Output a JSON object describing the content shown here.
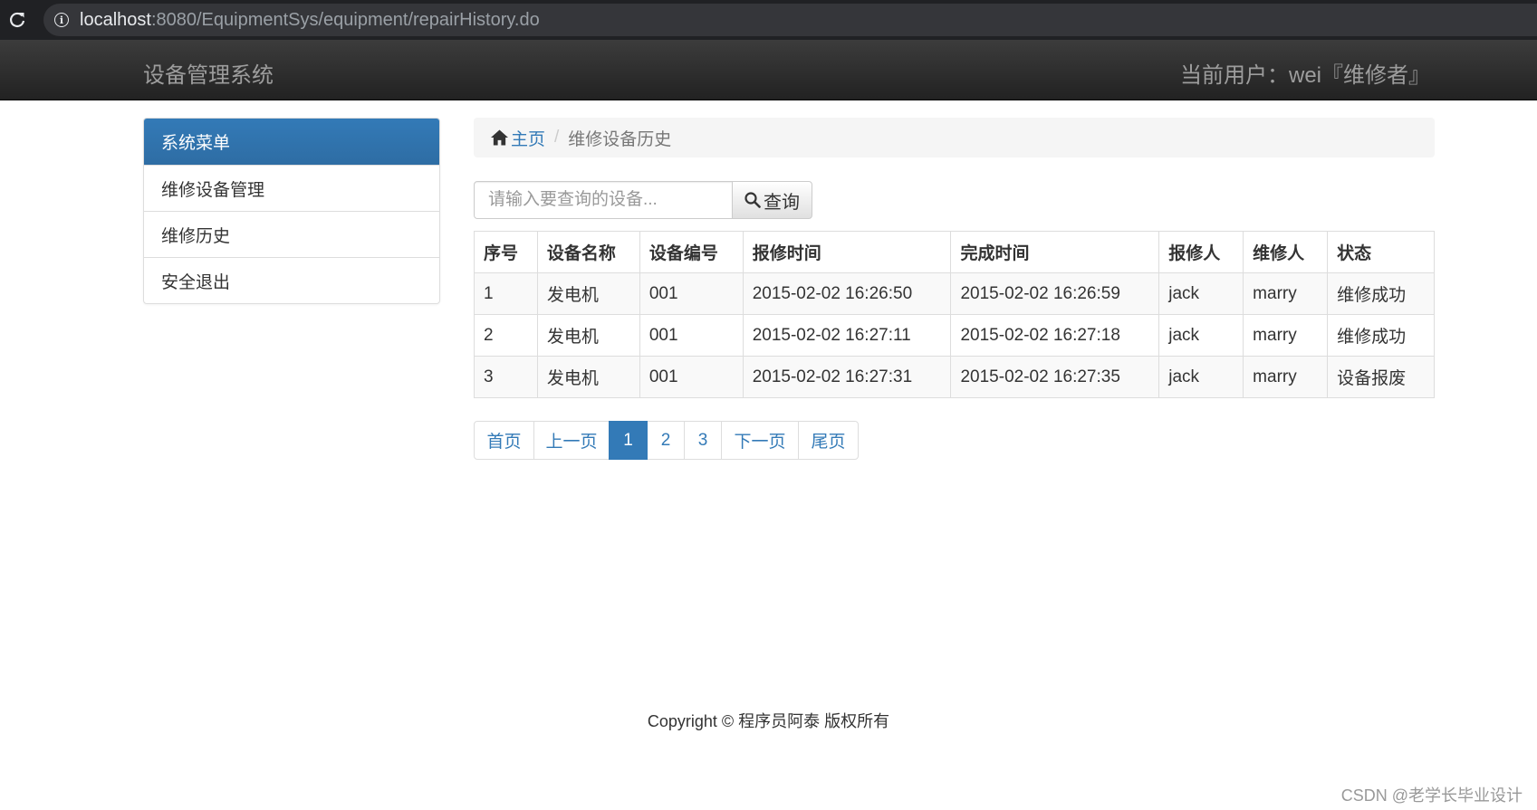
{
  "browser": {
    "url_host": "localhost",
    "url_path": ":8080/EquipmentSys/equipment/repairHistory.do"
  },
  "navbar": {
    "brand": "设备管理系统",
    "current_user": "当前用户：wei『维修者』"
  },
  "sidebar": {
    "heading": "系统菜单",
    "items": [
      {
        "label": "维修设备管理"
      },
      {
        "label": "维修历史"
      },
      {
        "label": "安全退出"
      }
    ]
  },
  "breadcrumb": {
    "home": "主页",
    "current": "维修设备历史"
  },
  "search": {
    "placeholder": "请输入要查询的设备...",
    "button_label": "查询"
  },
  "table": {
    "columns": [
      "序号",
      "设备名称",
      "设备编号",
      "报修时间",
      "完成时间",
      "报修人",
      "维修人",
      "状态"
    ],
    "rows": [
      [
        "1",
        "发电机",
        "001",
        "2015-02-02 16:26:50",
        "2015-02-02 16:26:59",
        "jack",
        "marry",
        "维修成功"
      ],
      [
        "2",
        "发电机",
        "001",
        "2015-02-02 16:27:11",
        "2015-02-02 16:27:18",
        "jack",
        "marry",
        "维修成功"
      ],
      [
        "3",
        "发电机",
        "001",
        "2015-02-02 16:27:31",
        "2015-02-02 16:27:35",
        "jack",
        "marry",
        "设备报废"
      ]
    ]
  },
  "pagination": {
    "first": "首页",
    "prev": "上一页",
    "pages": [
      "1",
      "2",
      "3"
    ],
    "next": "下一页",
    "last": "尾页"
  },
  "footer": {
    "copyright": "Copyright © 程序员阿泰 版权所有"
  },
  "watermark": "CSDN @老学长毕业设计",
  "colors": {
    "primary": "#337ab7",
    "navbar": "#222222"
  }
}
